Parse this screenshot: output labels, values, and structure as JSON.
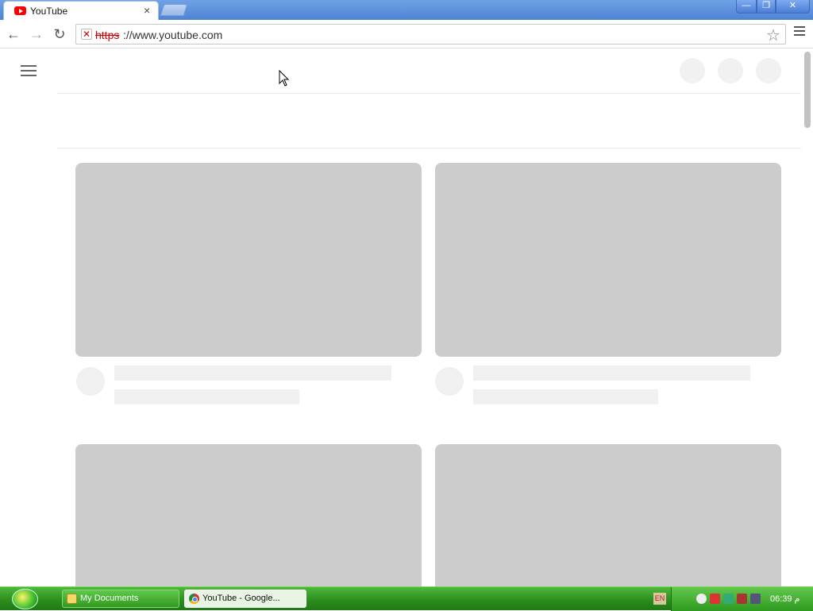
{
  "browser": {
    "tab": {
      "title": "YouTube",
      "close": "×"
    },
    "window_controls": {
      "minimize": "—",
      "maximize": "❐",
      "close": "✕"
    },
    "nav": {
      "back": "←",
      "forward": "→",
      "reload": "↻"
    },
    "address": {
      "scheme": "https",
      "rest": "://www.youtube.com",
      "security": "✕"
    },
    "star": "☆"
  },
  "page": {
    "cards": [
      {
        "row": 1,
        "column": 1
      },
      {
        "row": 1,
        "column": 2
      },
      {
        "row": 2,
        "column": 1
      },
      {
        "row": 2,
        "column": 2
      }
    ]
  },
  "taskbar": {
    "tasks": [
      {
        "label": "My Documents"
      },
      {
        "label": "YouTube - Google..."
      }
    ],
    "language": "EN",
    "clock": "06:39 م"
  },
  "colors": {
    "skeleton_thumb": "#cccccc",
    "skeleton_light": "#f0f0f0",
    "taskbar": "#2a8c1c",
    "youtube_red": "#ff0000"
  }
}
